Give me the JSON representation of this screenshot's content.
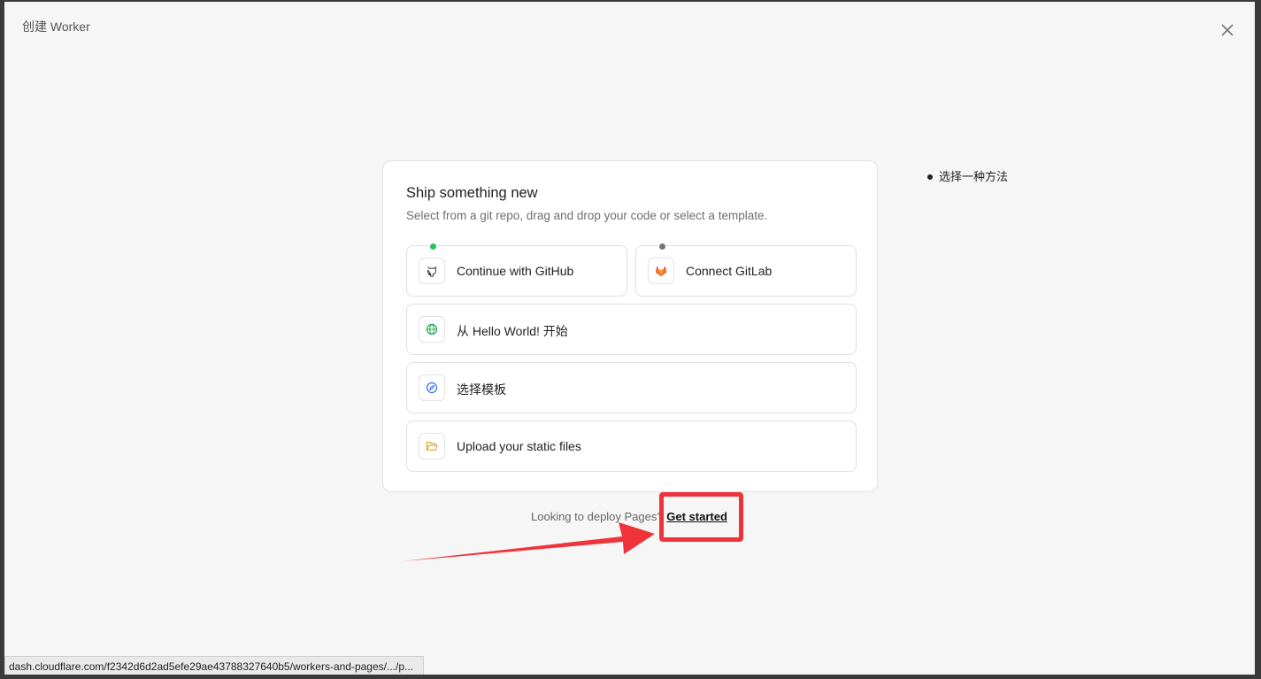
{
  "modal": {
    "title": "创建 Worker"
  },
  "card": {
    "title": "Ship something new",
    "subtitle": "Select from a git repo, drag and drop your code or select a template.",
    "options": [
      {
        "label": "Continue with GitHub",
        "icon": "github-icon",
        "status_color": "#22c55e"
      },
      {
        "label": "Connect GitLab",
        "icon": "gitlab-icon",
        "status_color": "#777777"
      },
      {
        "label": "从 Hello World! 开始",
        "icon": "globe-icon"
      },
      {
        "label": "选择模板",
        "icon": "compass-icon"
      },
      {
        "label": "Upload your static files",
        "icon": "folder-icon"
      }
    ]
  },
  "footer": {
    "text": "Looking to deploy Pages?",
    "link": "Get started"
  },
  "side_note": {
    "text": "选择一种方法"
  },
  "status_bar": {
    "url": "dash.cloudflare.com/f2342d6d2ad5efe29ae43788327640b5/workers-and-pages/.../p..."
  },
  "colors": {
    "annotation": "#f0323a",
    "background": "#f6f6f6"
  }
}
